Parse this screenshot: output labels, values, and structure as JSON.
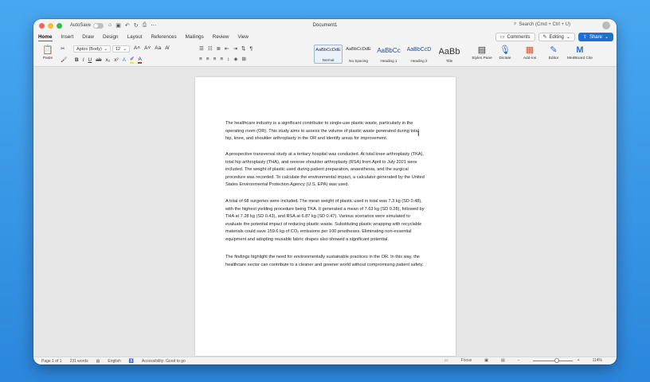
{
  "titlebar": {
    "autosave_label": "AutoSave",
    "document_title": "Document1",
    "search_placeholder": "Search (Cmd + Ctrl + U)"
  },
  "tabs": [
    "Home",
    "Insert",
    "Draw",
    "Design",
    "Layout",
    "References",
    "Mailings",
    "Review",
    "View"
  ],
  "tab_buttons": {
    "comments": "Comments",
    "editing": "Editing",
    "share": "Share"
  },
  "ribbon": {
    "paste_label": "Paste",
    "font_name": "Aptos (Body)",
    "font_size": "12",
    "styles": [
      {
        "sample": "AaBbCcDdE",
        "name": "Normal"
      },
      {
        "sample": "AaBbCcDdE",
        "name": "No Spacing"
      },
      {
        "sample": "AaBbCc",
        "name": "Heading 1"
      },
      {
        "sample": "AaBbCcD",
        "name": "Heading 2"
      },
      {
        "sample": "AaBb",
        "name": "Title"
      }
    ],
    "styles_pane": "Styles Pane",
    "dictate": "Dictate",
    "addins": "Add-ins",
    "editor": "Editor",
    "medboard": "MedBoard Cite"
  },
  "document": {
    "paragraphs": [
      "The healthcare industry is a significant contributor to single-use plastic waste, particularly in the operating room (OR). This study aims to assess the volume of plastic waste generated during total hip, knee, and shoulder arthroplasty in the OR and identify areas for improvement.",
      "A prospective transversal study at a tertiary hospital was conducted. At total knee arthroplasty (TKA), total hip arthroplasty (THA), and reverse shoulder arthroplasty (RSA) from April to July 2021 were included. The weight of plastic used during patient preparation, anaesthesia, and the surgical procedure was recorded. To calculate the environmental impact, a calculator generated by the United States Environmental Protection Agency (U.S. EPA) was used.",
      "A total of 68 surgeries were included. The mean weight of plastic used in total was 7.3 kg (SD 0.48), with the highest yielding procedure being TKA. It generated a mean of 7.63 kg (SD 0.28), followed by THA at 7.28 kg (SD 0.43), and RSA at 6.87 kg (SD 0.47). Various scenarios were simulated to evaluate the potential impact of reducing plastic waste. Substituting plastic wrapping with recyclable materials could save 159.6 kg of CO₂ emissions per 100 prostheses. Eliminating non-essential equipment and adopting reusable fabric drapes also showed a significant potential.",
      "The findings highlight the need for environmentally sustainable practices in the OR. In this way, the healthcare sector can contribute to a cleaner and greener world without compromising patient safety."
    ]
  },
  "status": {
    "page": "Page 1 of 1",
    "words": "231 words",
    "language": "English",
    "accessibility": "Accessibility: Good to go",
    "focus": "Focus",
    "zoom": "114%"
  },
  "colors": {
    "accent": "#1f6fd1",
    "highlight": "#ffe600",
    "font_color": "#e02b2b"
  }
}
